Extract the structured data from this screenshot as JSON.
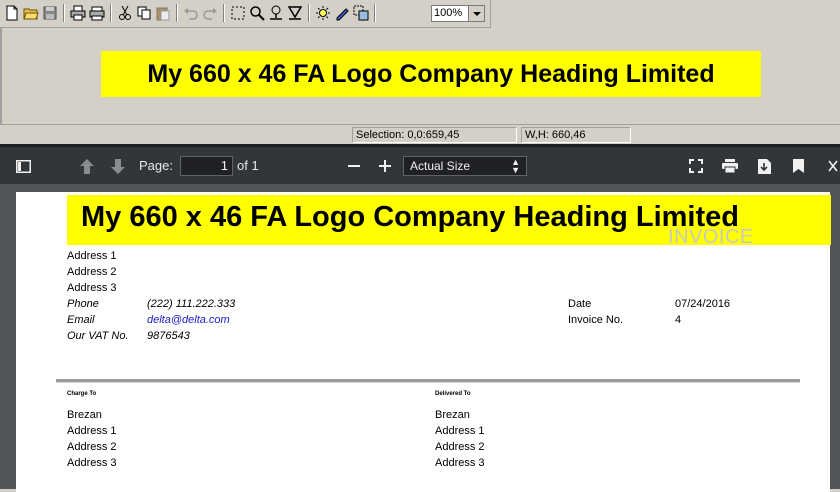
{
  "editor": {
    "toolbar_icons": [
      "new-file-icon",
      "open-folder-icon",
      "save-icon",
      "print-icon",
      "print-preview-icon",
      "cut-icon",
      "copy-icon",
      "paste-icon",
      "undo-icon",
      "redo-icon",
      "select-rectangle-icon",
      "zoom-icon",
      "pin-icon",
      "filter-icon",
      "brightness-icon",
      "pen-icon",
      "select-region-icon"
    ],
    "zoom": "100%",
    "canvas_logo_text": "My 660 x 46 FA Logo Company Heading Limited",
    "status": {
      "selection": "Selection: 0,0:659,45",
      "size": "W,H: 660,46"
    }
  },
  "viewer": {
    "page_label": "Page:",
    "page_current": "1",
    "page_total": "of 1",
    "fit_mode": "Actual Size",
    "colors": {
      "toolbar_bg": "#323639",
      "viewer_bg": "#525659",
      "logo_bg": "#ffff00"
    }
  },
  "invoice": {
    "logo_text": "My 660 x 46 FA Logo Company Heading Limited",
    "title": "INVOICE",
    "company_address": [
      "Address 1",
      "Address 2",
      "Address 3"
    ],
    "phone_label": "Phone",
    "phone": "(222) 111.222.333",
    "email_label": "Email",
    "email": "delta@delta.com",
    "vat_label": "Our VAT No.",
    "vat": "9876543",
    "date_label": "Date",
    "date": "07/24/2016",
    "invoice_no_label": "Invoice No.",
    "invoice_no": "4",
    "charge_to_label": "Charge To",
    "charge_to": [
      "Brezan",
      "Address 1",
      "Address 2",
      "Address 3"
    ],
    "delivered_to_label": "Delivered To",
    "delivered_to": [
      "Brezan",
      "Address 1",
      "Address 2",
      "Address 3"
    ]
  }
}
